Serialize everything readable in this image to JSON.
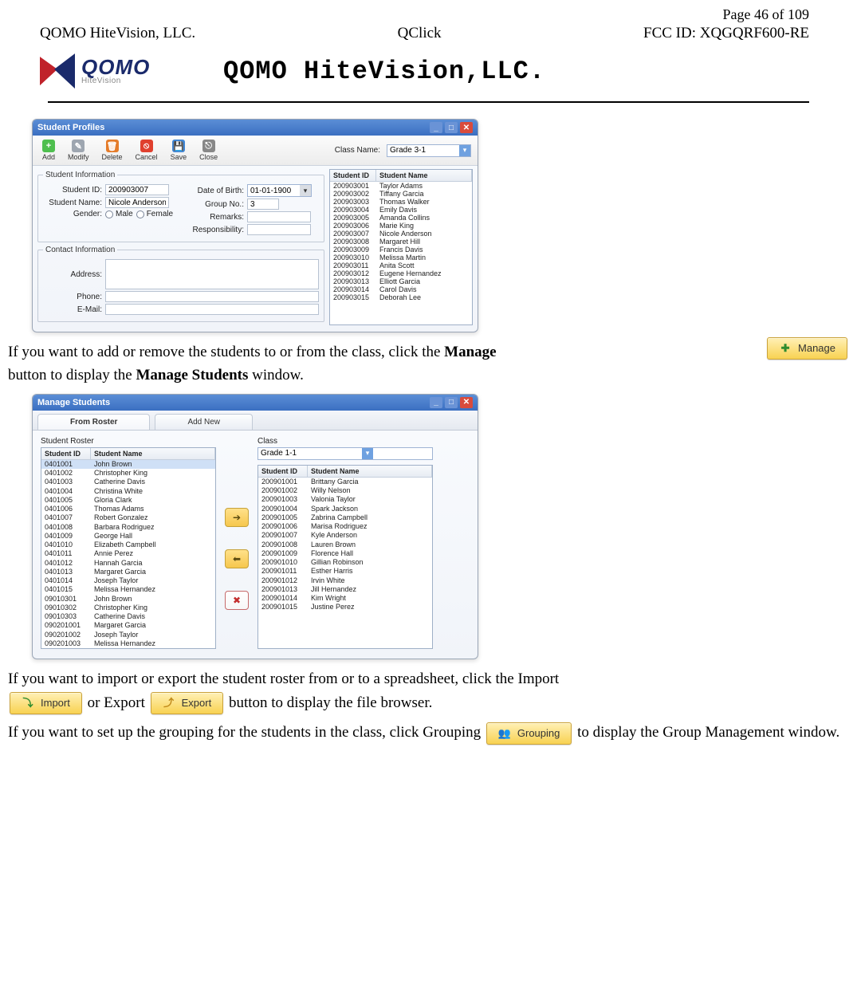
{
  "page": {
    "page_label_prefix": "Page ",
    "page_number": "46",
    "page_of": " of 109",
    "company": "QOMO HiteVision, LLC.",
    "product": "QClick",
    "fcc": "FCC ID: XQGQRF600-RE",
    "logo_main": "QOMO",
    "logo_sub": "HiteVision",
    "brand_title": "QOMO HiteVision,LLC."
  },
  "sp": {
    "title": "Student Profiles",
    "toolbar": {
      "add": "Add",
      "modify": "Modify",
      "delete": "Delete",
      "cancel": "Cancel",
      "save": "Save",
      "close": "Close",
      "class_label": "Class Name:",
      "class_value": "Grade 3-1"
    },
    "group_info": "Student Information",
    "group_contact": "Contact Information",
    "labels": {
      "student_id": "Student ID:",
      "student_name": "Student Name:",
      "gender": "Gender:",
      "male": "Male",
      "female": "Female",
      "dob": "Date of Birth:",
      "group": "Group No.:",
      "remarks": "Remarks:",
      "responsibility": "Responsibility:",
      "address": "Address:",
      "phone": "Phone:",
      "email": "E-Mail:"
    },
    "values": {
      "student_id": "200903007",
      "student_name": "Nicole Anderson",
      "dob": "01-01-1900",
      "group": "3"
    },
    "table": {
      "col_id": "Student ID",
      "col_name": "Student Name",
      "rows": [
        {
          "id": "200903001",
          "name": "Taylor Adams"
        },
        {
          "id": "200903002",
          "name": "Tiffany Garcia"
        },
        {
          "id": "200903003",
          "name": "Thomas Walker"
        },
        {
          "id": "200903004",
          "name": "Emily Davis"
        },
        {
          "id": "200903005",
          "name": "Amanda Collins"
        },
        {
          "id": "200903006",
          "name": "Marie King"
        },
        {
          "id": "200903007",
          "name": "Nicole Anderson"
        },
        {
          "id": "200903008",
          "name": "Margaret Hill"
        },
        {
          "id": "200903009",
          "name": "Francis Davis"
        },
        {
          "id": "200903010",
          "name": "Melissa Martin"
        },
        {
          "id": "200903011",
          "name": "Anita Scott"
        },
        {
          "id": "200903012",
          "name": "Eugene Hernandez"
        },
        {
          "id": "200903013",
          "name": "Elliott Garcia"
        },
        {
          "id": "200903014",
          "name": "Carol Davis"
        },
        {
          "id": "200903015",
          "name": "Deborah Lee"
        }
      ]
    }
  },
  "para1": {
    "t1": "If you want to add or remove the students to or from the class, click the ",
    "manage_bold": "Manage",
    "t2": " button to display the ",
    "ms_bold": "Manage Students",
    "t3": " window."
  },
  "ybtn_manage": "Manage",
  "ms": {
    "title": "Manage Students",
    "tab_from": "From Roster",
    "tab_add": "Add New",
    "roster_label": "Student Roster",
    "class_label": "Class",
    "class_value": "Grade 1-1",
    "col_id": "Student ID",
    "col_name": "Student Name",
    "roster_rows": [
      {
        "id": "0401001",
        "name": "John Brown"
      },
      {
        "id": "0401002",
        "name": "Christopher King"
      },
      {
        "id": "0401003",
        "name": "Catherine Davis"
      },
      {
        "id": "0401004",
        "name": "Christina White"
      },
      {
        "id": "0401005",
        "name": "Gloria Clark"
      },
      {
        "id": "0401006",
        "name": "Thomas Adams"
      },
      {
        "id": "0401007",
        "name": "Robert Gonzalez"
      },
      {
        "id": "0401008",
        "name": "Barbara Rodriguez"
      },
      {
        "id": "0401009",
        "name": "George Hall"
      },
      {
        "id": "0401010",
        "name": "Elizabeth Campbell"
      },
      {
        "id": "0401011",
        "name": "Annie Perez"
      },
      {
        "id": "0401012",
        "name": "Hannah Garcia"
      },
      {
        "id": "0401013",
        "name": "Margaret Garcia"
      },
      {
        "id": "0401014",
        "name": "Joseph Taylor"
      },
      {
        "id": "0401015",
        "name": "Melissa Hernandez"
      },
      {
        "id": "09010301",
        "name": "John Brown"
      },
      {
        "id": "09010302",
        "name": "Christopher King"
      },
      {
        "id": "09010303",
        "name": "Catherine Davis"
      },
      {
        "id": "090201001",
        "name": "Margaret Garcia"
      },
      {
        "id": "090201002",
        "name": "Joseph Taylor"
      },
      {
        "id": "090201003",
        "name": "Melissa Hernandez"
      }
    ],
    "class_rows": [
      {
        "id": "200901001",
        "name": "Brittany Garcia"
      },
      {
        "id": "200901002",
        "name": "Willy Nelson"
      },
      {
        "id": "200901003",
        "name": "Valonia Taylor"
      },
      {
        "id": "200901004",
        "name": "Spark Jackson"
      },
      {
        "id": "200901005",
        "name": "Zabrina Campbell"
      },
      {
        "id": "200901006",
        "name": "Marisa Rodriguez"
      },
      {
        "id": "200901007",
        "name": "Kyle Anderson"
      },
      {
        "id": "200901008",
        "name": "Lauren Brown"
      },
      {
        "id": "200901009",
        "name": "Florence Hall"
      },
      {
        "id": "200901010",
        "name": "Gillian Robinson"
      },
      {
        "id": "200901011",
        "name": "Esther Harris"
      },
      {
        "id": "200901012",
        "name": "Irvin White"
      },
      {
        "id": "200901013",
        "name": "Jill Hernandez"
      },
      {
        "id": "200901014",
        "name": "Kim Wright"
      },
      {
        "id": "200901015",
        "name": "Justine Perez"
      }
    ]
  },
  "para2": {
    "t1": "If you want to import or export the student roster from or to a spreadsheet, click the Import ",
    "t2": "or Export",
    "t3": "   button to display the file browser."
  },
  "ybtn_import": "Import",
  "ybtn_export": "Export",
  "para3": {
    "t1": "If you want to set up the grouping for the students in the class, click Grouping",
    "t2": "to display the Group Management window."
  },
  "ybtn_grouping": "Grouping"
}
